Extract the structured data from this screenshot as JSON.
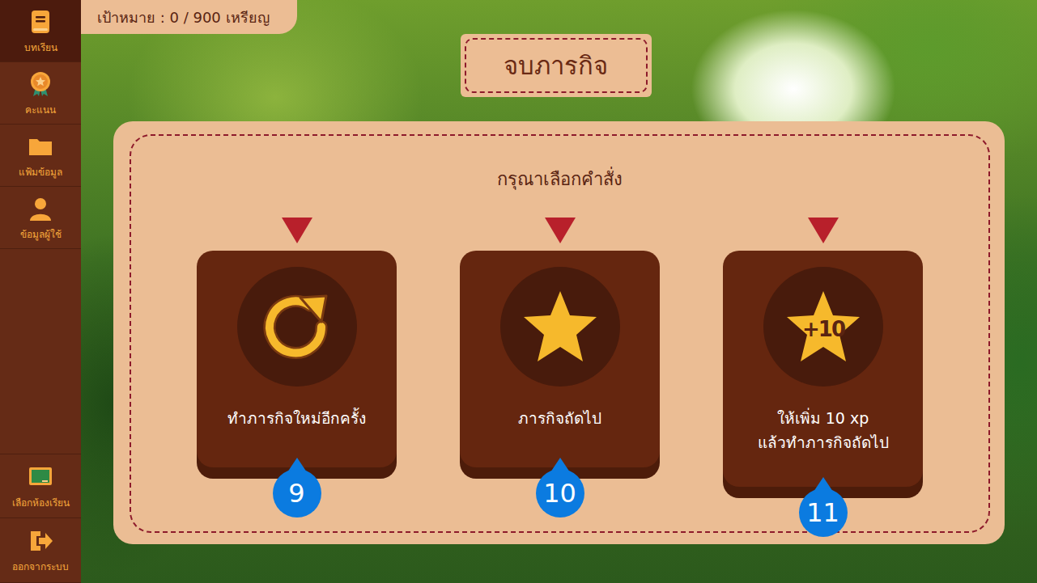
{
  "goal": {
    "label": "เป้าหมาย : 0 / 900 เหรียญ"
  },
  "sidebar": {
    "items": [
      {
        "label": "บทเรียน",
        "kind": "book",
        "selected": true
      },
      {
        "label": "คะแนน",
        "kind": "medal",
        "selected": false
      },
      {
        "label": "แฟ้มข้อมูล",
        "kind": "folder",
        "selected": false
      },
      {
        "label": "ข้อมูลผู้ใช้",
        "kind": "user",
        "selected": false
      }
    ],
    "bottom_items": [
      {
        "label": "เลือกห้องเรียน",
        "kind": "board",
        "selected": false
      },
      {
        "label": "ออกจากระบบ",
        "kind": "exit",
        "selected": false
      }
    ]
  },
  "title": "จบภารกิจ",
  "panel": {
    "heading": "กรุณาเลือกคำสั่ง",
    "options": [
      {
        "lines": [
          "ทำภารกิจใหม่อีกครั้ง"
        ],
        "kind": "retry",
        "badge": "9"
      },
      {
        "lines": [
          "ภารกิจถัดไป"
        ],
        "kind": "star",
        "badge": "10"
      },
      {
        "lines": [
          "ให้เพิ่ม 10 xp",
          "แล้วทำภารกิจถัดไป"
        ],
        "kind": "bonus",
        "icon_text": "+10",
        "badge": "11"
      }
    ]
  }
}
